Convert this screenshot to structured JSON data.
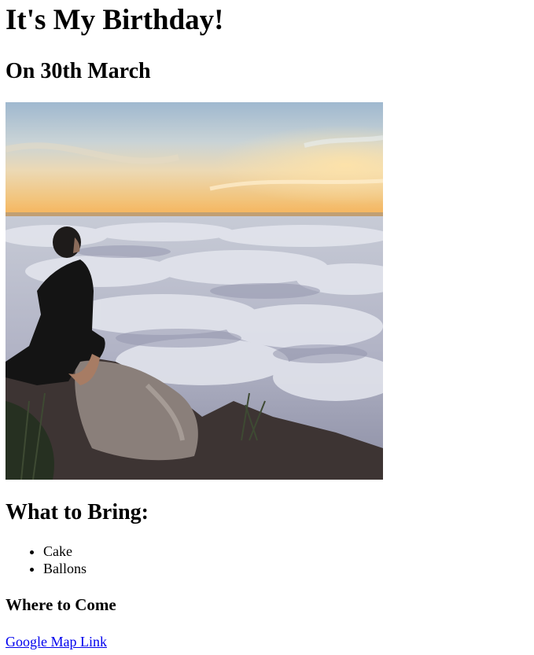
{
  "page": {
    "title": "It's My Birthday!",
    "date_heading": "On 30th March",
    "photo_description": "",
    "bring_heading": "What to Bring:",
    "bring_items": [
      "Cake",
      "Ballons"
    ],
    "where_heading": "Where to Come",
    "map_link_label": "Google Map Link"
  }
}
